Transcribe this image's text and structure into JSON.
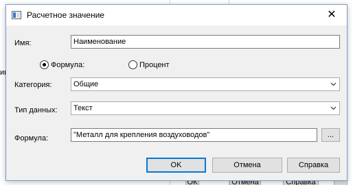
{
  "background": {
    "side_text": "ик",
    "buttons": [
      "ОК",
      "Отмена",
      "Справка"
    ]
  },
  "dialog": {
    "title": "Расчетное значение",
    "close_glyph": "✕",
    "name_label": "Имя:",
    "name_value": "Наименование",
    "radio_formula_label": "Формула:",
    "radio_percent_label": "Процент",
    "selected_radio": "formula",
    "category_label": "Категория:",
    "category_value": "Общие",
    "datatype_label": "Тип данных:",
    "datatype_value": "Текст",
    "formula_label": "Формула:",
    "formula_value": "\"Металл для крепления воздуховодов\"",
    "browse_label": "...",
    "ok_label": "OK",
    "cancel_label": "Отмена",
    "help_label": "Справка"
  },
  "colors": {
    "accent": "#0078d7",
    "window_bg": "#f0f0f0"
  },
  "icons": {
    "title": "window-app-icon",
    "close": "close-icon",
    "dropdown": "chevron-down-icon"
  }
}
